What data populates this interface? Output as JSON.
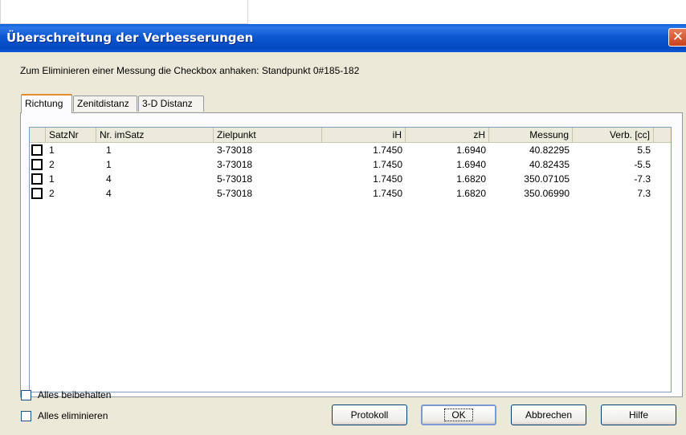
{
  "window": {
    "title": "Überschreitung der Verbesserungen",
    "close_glyph": "✕"
  },
  "instruction": "Zum Eliminieren einer Messung die Checkbox anhaken: Standpunkt 0#185-182",
  "tabs": [
    {
      "label": "Richtung",
      "active": true
    },
    {
      "label": "Zenitdistanz",
      "active": false
    },
    {
      "label": "3-D Distanz",
      "active": false
    }
  ],
  "table": {
    "columns": [
      "SatzNr",
      "Nr. imSatz",
      "Zielpunkt",
      "iH",
      "zH",
      "Messung",
      "Verb. [cc]"
    ],
    "rows": [
      {
        "checked": false,
        "satznr": "1",
        "nr_imsatz": "1",
        "zielpunkt": "3-73018",
        "ih": "1.7450",
        "zh": "1.6940",
        "messung": "40.82295",
        "verb": "5.5"
      },
      {
        "checked": false,
        "satznr": "2",
        "nr_imsatz": "1",
        "zielpunkt": "3-73018",
        "ih": "1.7450",
        "zh": "1.6940",
        "messung": "40.82435",
        "verb": "-5.5"
      },
      {
        "checked": false,
        "satznr": "1",
        "nr_imsatz": "4",
        "zielpunkt": "5-73018",
        "ih": "1.7450",
        "zh": "1.6820",
        "messung": "350.07105",
        "verb": "-7.3"
      },
      {
        "checked": false,
        "satznr": "2",
        "nr_imsatz": "4",
        "zielpunkt": "5-73018",
        "ih": "1.7450",
        "zh": "1.6820",
        "messung": "350.06990",
        "verb": "7.3"
      }
    ]
  },
  "options": {
    "keep_all": {
      "label": "Alles beibehalten",
      "checked": false
    },
    "eliminate_all": {
      "label": "Alles eliminieren",
      "checked": false
    }
  },
  "buttons": {
    "protokoll": "Protokoll",
    "ok": "OK",
    "abbrechen": "Abbrechen",
    "hilfe": "Hilfe"
  },
  "colors": {
    "titlebar": "#0454d2",
    "close": "#d95a33",
    "dialog_bg": "#ece9d8",
    "tab_accent": "#e68b2c"
  }
}
